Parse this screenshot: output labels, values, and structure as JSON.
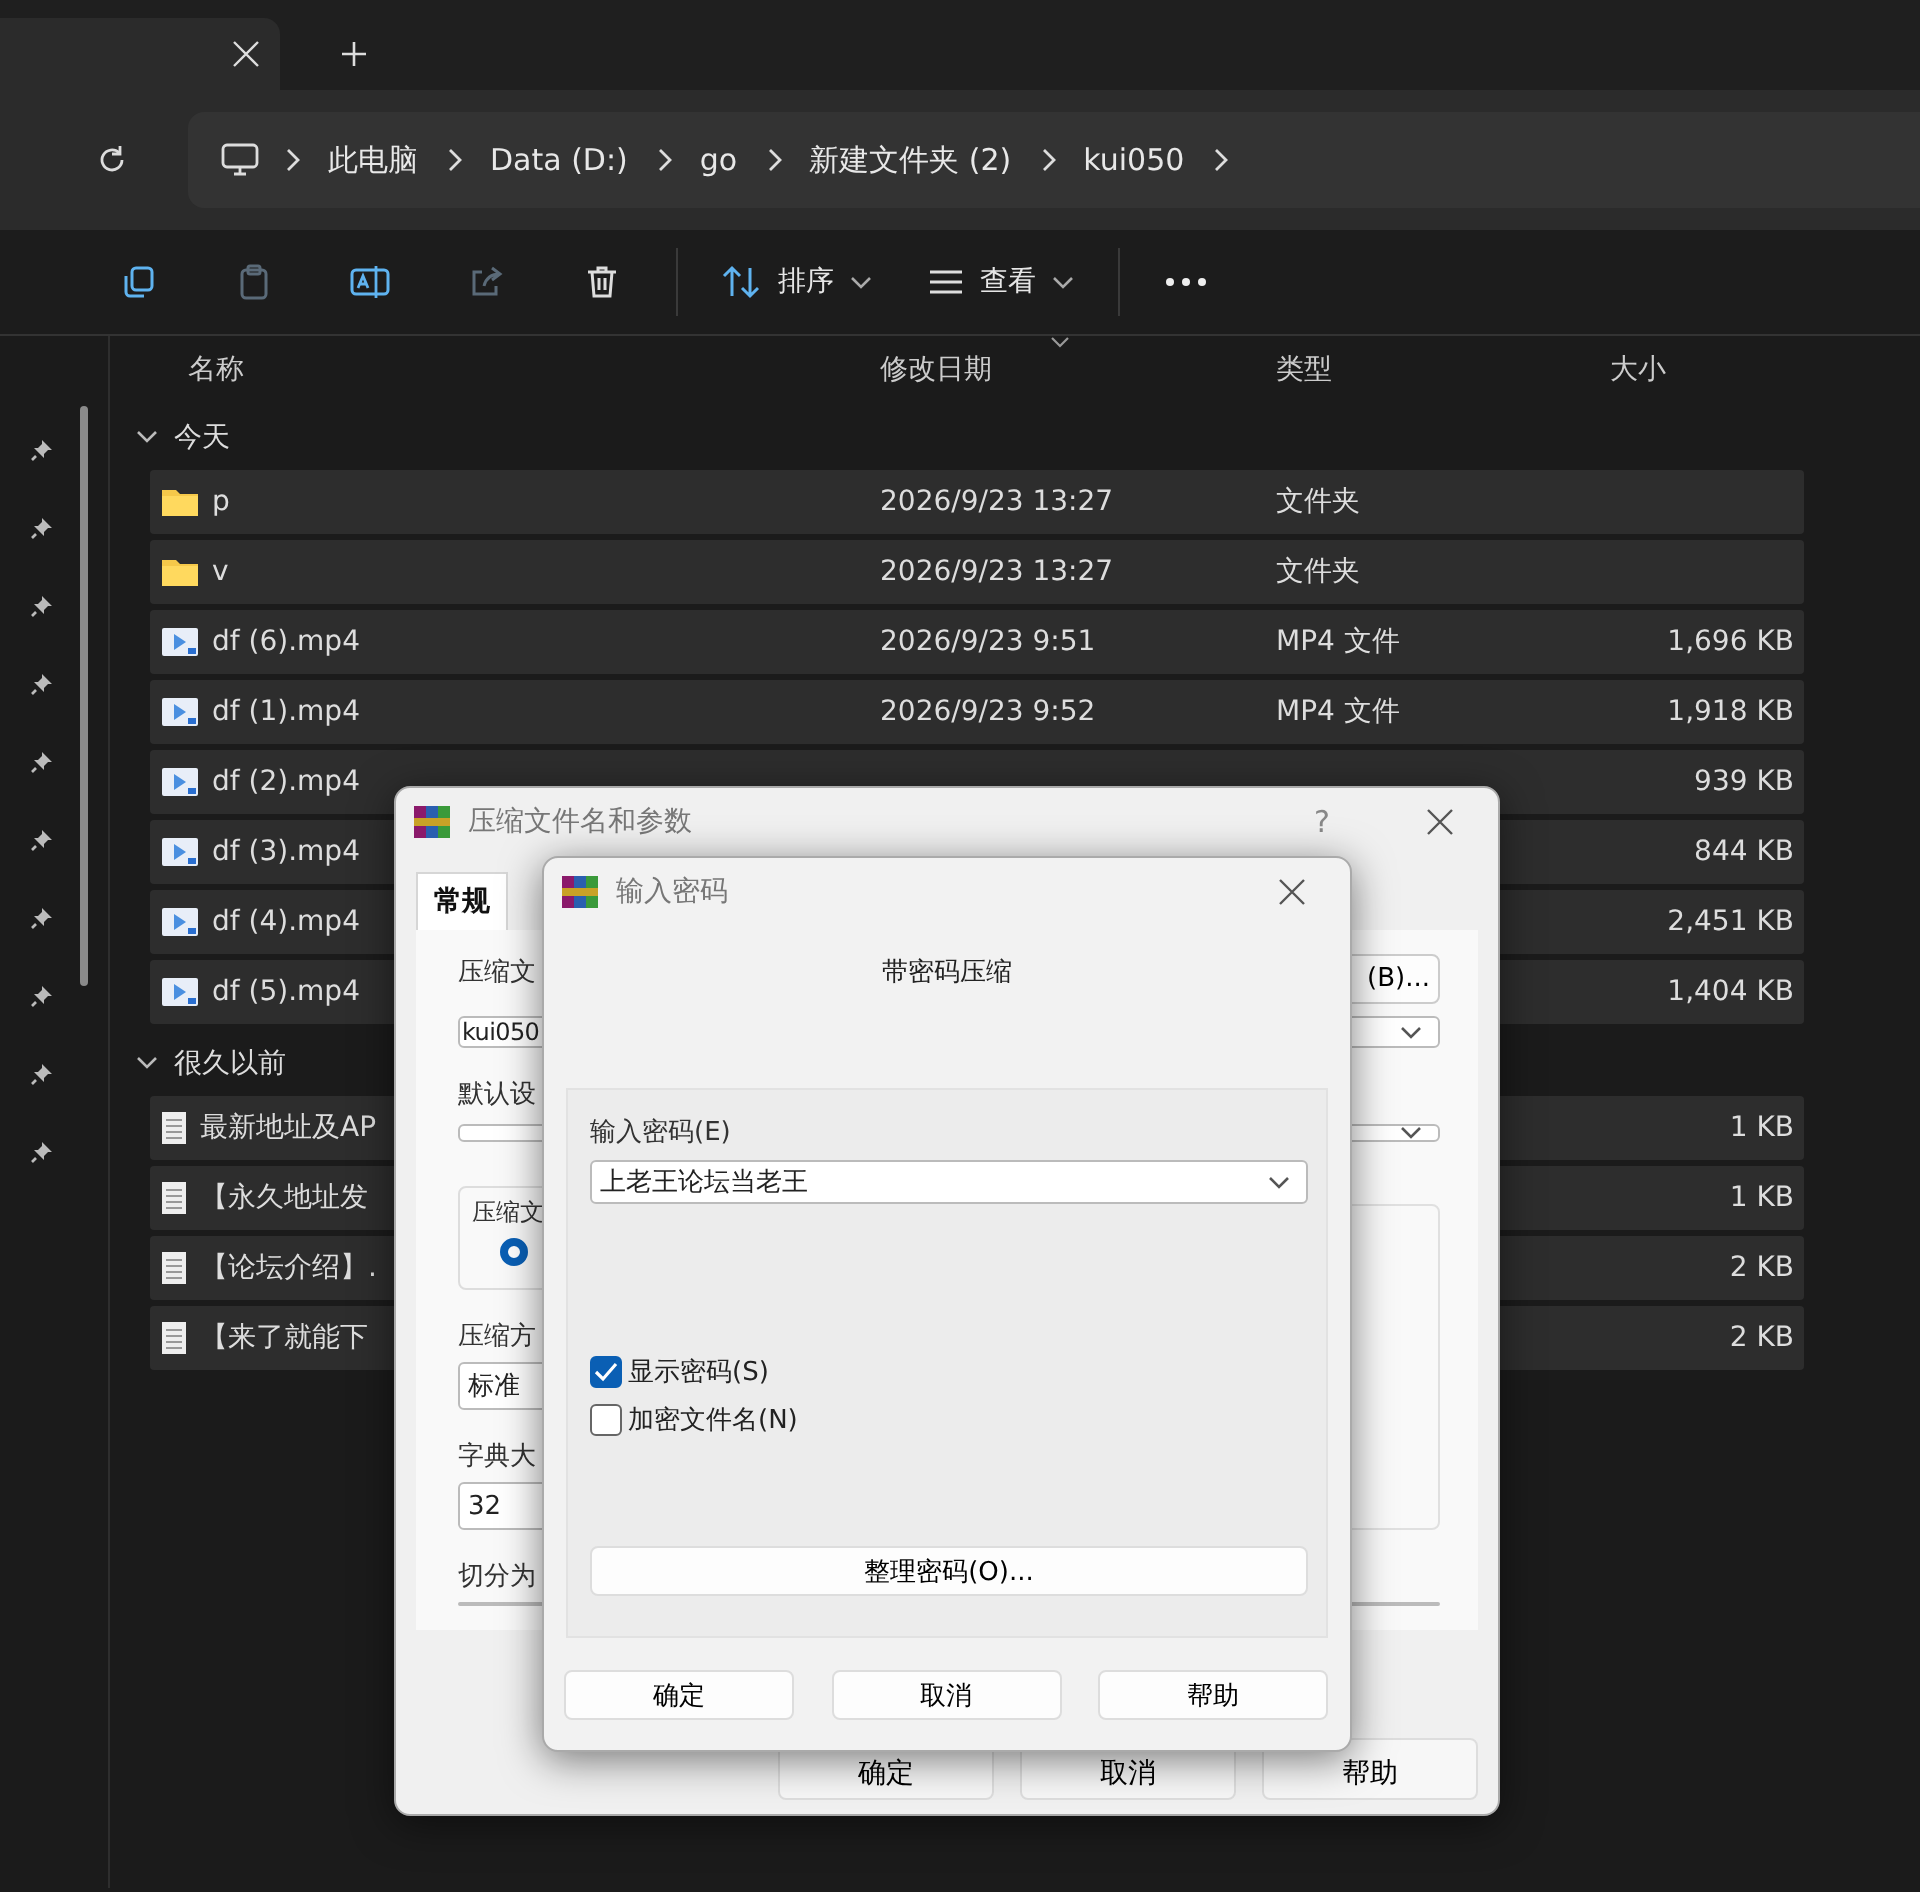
{
  "tab_bar": {
    "tabs": [
      {
        "selected": true
      }
    ]
  },
  "address_bar": {
    "crumbs": [
      "此电脑",
      "Data (D:)",
      "go",
      "新建文件夹 (2)",
      "kui050"
    ]
  },
  "toolbar": {
    "buttons": [
      {
        "kind": "copy",
        "disabled": false
      },
      {
        "kind": "paste",
        "disabled": true
      },
      {
        "kind": "rename",
        "disabled": false
      },
      {
        "kind": "share",
        "disabled": true
      },
      {
        "kind": "delete",
        "disabled": false
      }
    ],
    "sort": "排序",
    "view": "查看"
  },
  "columns": [
    "名称",
    "修改日期",
    "类型",
    "大小"
  ],
  "groups": [
    {
      "label": "今天",
      "expanded": true,
      "rows": [
        {
          "kind": "folder",
          "name": "p",
          "date": "2026/9/23 13:27",
          "type": "文件夹"
        },
        {
          "kind": "folder",
          "name": "v",
          "date": "2026/9/23 13:27",
          "type": "文件夹"
        },
        {
          "kind": "video",
          "name": "df (6).mp4",
          "date": "2026/9/23 9:51",
          "type": "MP4 文件",
          "size": "1,696 KB"
        },
        {
          "kind": "video",
          "name": "df (1).mp4",
          "date": "2026/9/23 9:52",
          "type": "MP4 文件",
          "size": "1,918 KB"
        },
        {
          "kind": "video",
          "name": "df (2).mp4",
          "size": "939 KB"
        },
        {
          "kind": "video",
          "name": "df (3).mp4",
          "size": "844 KB"
        },
        {
          "kind": "video",
          "name": "df (4).mp4",
          "size": "2,451 KB"
        },
        {
          "kind": "video",
          "name": "df (5).mp4",
          "size": "1,404 KB"
        }
      ]
    },
    {
      "label": "很久以前",
      "expanded": true,
      "rows": [
        {
          "kind": "text",
          "name": "最新地址及AP",
          "size": "1 KB"
        },
        {
          "kind": "text",
          "name": "【永久地址发",
          "size": "1 KB"
        },
        {
          "kind": "text",
          "name": "【论坛介绍】.",
          "size": "2 KB"
        },
        {
          "kind": "text",
          "name": "【来了就能下",
          "size": "2 KB"
        }
      ]
    }
  ],
  "archive_dialog": {
    "title": "压缩文件名和参数",
    "help": "?",
    "tabs": [
      {
        "label": "常规",
        "selected": true
      }
    ],
    "name_label": "压缩文",
    "name_value": "kui050",
    "browse_button": "(B)...",
    "profile_label": "默认设",
    "format_label": "压缩文",
    "format_radio": {
      "selected": true
    },
    "method_label": "压缩方",
    "method_value": "标准",
    "dict_label": "字典大",
    "dict_value": "32",
    "split_label": "切分为",
    "buttons": [
      "确定",
      "取消",
      "帮助"
    ]
  },
  "password_dialog": {
    "title": "输入密码",
    "heading": "带密码压缩",
    "password_label": "输入密码(E)",
    "password_value": "上老王论坛当老王",
    "options": [
      {
        "label": "显示密码(S)",
        "checked": true
      },
      {
        "label": "加密文件名(N)",
        "checked": false
      }
    ],
    "organize_button": "整理密码(O)...",
    "buttons": [
      "确定",
      "取消",
      "帮助"
    ]
  }
}
